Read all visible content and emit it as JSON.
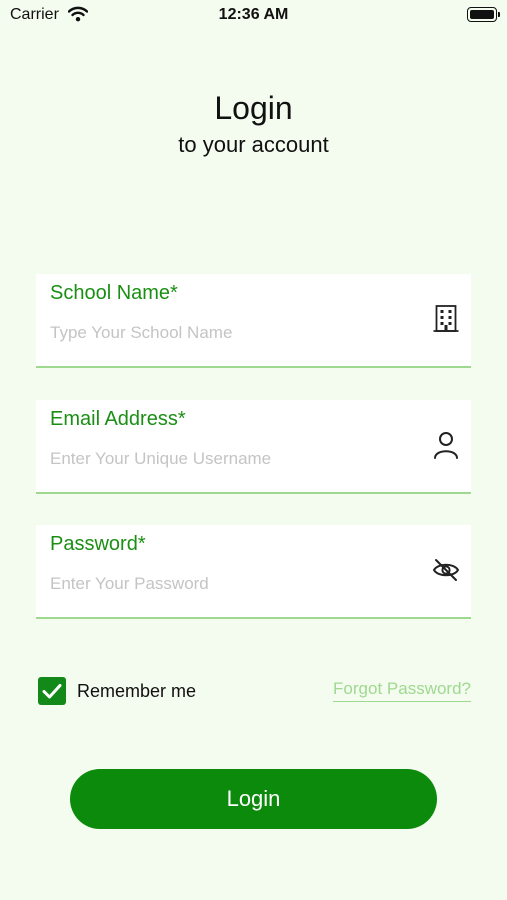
{
  "status_bar": {
    "carrier": "Carrier",
    "time": "12:36 AM",
    "wifi_icon": "wifi-icon",
    "battery_icon": "battery-icon"
  },
  "header": {
    "title": "Login",
    "subtitle": "to your account"
  },
  "fields": {
    "school": {
      "label": "School Name*",
      "placeholder": "Type Your School Name",
      "value": "",
      "icon": "building-icon"
    },
    "email": {
      "label": "Email Address*",
      "placeholder": "Enter Your Unique Username",
      "value": "",
      "icon": "user-icon"
    },
    "password": {
      "label": "Password*",
      "placeholder": "Enter Your Password",
      "value": "",
      "icon": "eye-slash-icon"
    }
  },
  "options": {
    "remember_label": "Remember me",
    "remember_checked": true,
    "forgot_label": "Forgot Password?"
  },
  "login_button": {
    "label": "Login"
  },
  "colors": {
    "background": "#f4fbef",
    "accent": "#0c8a0c",
    "label_green": "#1b8f14",
    "link_green": "#9fd98f",
    "underline_green": "#9ed98f"
  }
}
